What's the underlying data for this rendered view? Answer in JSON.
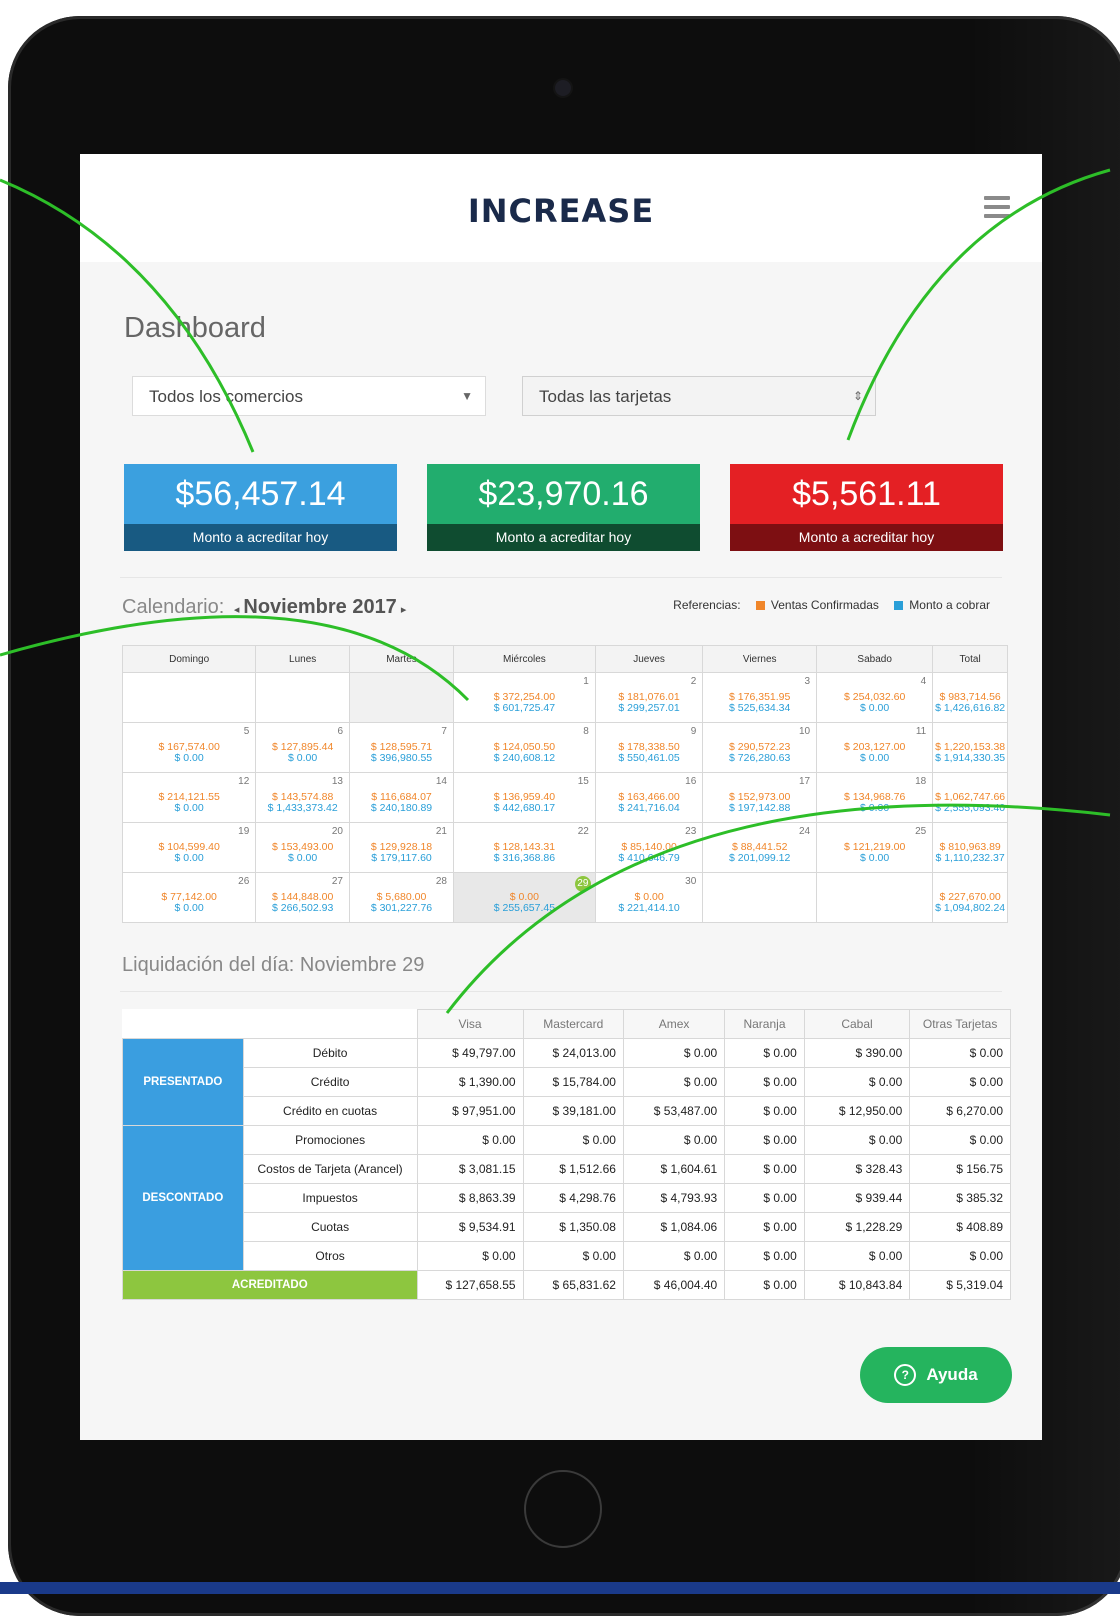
{
  "app": {
    "logo": "INCREASE"
  },
  "dashboard": {
    "title": "Dashboard"
  },
  "filters": {
    "merchant": "Todos los comercios",
    "cards": "Todas las tarjetas"
  },
  "cards": [
    {
      "amount": "$56,457.14",
      "label": "Monto a acreditar hoy",
      "color": "#3ba0df",
      "dark": "#185a82"
    },
    {
      "amount": "$23,970.16",
      "label": "Monto a acreditar hoy",
      "color": "#22ad6e",
      "dark": "#0f4c30"
    },
    {
      "amount": "$5,561.11",
      "label": "Monto a acreditar hoy",
      "color": "#e42024",
      "dark": "#7d0f12"
    }
  ],
  "calendar": {
    "label": "Calendario:",
    "month": "Noviembre 2017",
    "refs_label": "Referencias:",
    "ref_confirmed": "Ventas Confirmadas",
    "ref_collect": "Monto a cobrar",
    "orange": "#f0862a",
    "blue": "#2a9fd8",
    "headers": [
      "Domingo",
      "Lunes",
      "Martes",
      "Miércoles",
      "Jueves",
      "Viernes",
      "Sabado",
      "Total"
    ],
    "weeks": [
      [
        {
          "d": "",
          "o": "",
          "b": ""
        },
        {
          "d": "",
          "o": "",
          "b": ""
        },
        {
          "d": "",
          "o": "",
          "b": "",
          "shade": true
        },
        {
          "d": "1",
          "o": "$ 372,254.00",
          "b": "$ 601,725.47"
        },
        {
          "d": "2",
          "o": "$ 181,076.01",
          "b": "$ 299,257.01"
        },
        {
          "d": "3",
          "o": "$ 176,351.95",
          "b": "$ 525,634.34"
        },
        {
          "d": "4",
          "o": "$ 254,032.60",
          "b": "$ 0.00"
        },
        {
          "d": "",
          "o": "$ 983,714.56",
          "b": "$ 1,426,616.82"
        }
      ],
      [
        {
          "d": "5",
          "o": "$ 167,574.00",
          "b": "$ 0.00"
        },
        {
          "d": "6",
          "o": "$ 127,895.44",
          "b": "$ 0.00"
        },
        {
          "d": "7",
          "o": "$ 128,595.71",
          "b": "$ 396,980.55"
        },
        {
          "d": "8",
          "o": "$ 124,050.50",
          "b": "$ 240,608.12"
        },
        {
          "d": "9",
          "o": "$ 178,338.50",
          "b": "$ 550,461.05"
        },
        {
          "d": "10",
          "o": "$ 290,572.23",
          "b": "$ 726,280.63"
        },
        {
          "d": "11",
          "o": "$ 203,127.00",
          "b": "$ 0.00"
        },
        {
          "d": "",
          "o": "$ 1,220,153.38",
          "b": "$ 1,914,330.35"
        }
      ],
      [
        {
          "d": "12",
          "o": "$ 214,121.55",
          "b": "$ 0.00"
        },
        {
          "d": "13",
          "o": "$ 143,574.88",
          "b": "$ 1,433,373.42"
        },
        {
          "d": "14",
          "o": "$ 116,684.07",
          "b": "$ 240,180.89"
        },
        {
          "d": "15",
          "o": "$ 136,959.40",
          "b": "$ 442,680.17"
        },
        {
          "d": "16",
          "o": "$ 163,466.00",
          "b": "$ 241,716.04"
        },
        {
          "d": "17",
          "o": "$ 152,973.00",
          "b": "$ 197,142.88"
        },
        {
          "d": "18",
          "o": "$ 134,968.76",
          "b": "$ 0.00"
        },
        {
          "d": "",
          "o": "$ 1,062,747.66",
          "b": "$ 2,555,093.40"
        }
      ],
      [
        {
          "d": "19",
          "o": "$ 104,599.40",
          "b": "$ 0.00"
        },
        {
          "d": "20",
          "o": "$ 153,493.00",
          "b": "$ 0.00"
        },
        {
          "d": "21",
          "o": "$ 129,928.18",
          "b": "$ 179,117.60"
        },
        {
          "d": "22",
          "o": "$ 128,143.31",
          "b": "$ 316,368.86"
        },
        {
          "d": "23",
          "o": "$ 85,140.00",
          "b": "$ 410,646.79"
        },
        {
          "d": "24",
          "o": "$ 88,441.52",
          "b": "$ 201,099.12"
        },
        {
          "d": "25",
          "o": "$ 121,219.00",
          "b": "$ 0.00"
        },
        {
          "d": "",
          "o": "$ 810,963.89",
          "b": "$ 1,110,232.37"
        }
      ],
      [
        {
          "d": "26",
          "o": "$ 77,142.00",
          "b": "$ 0.00"
        },
        {
          "d": "27",
          "o": "$ 144,848.00",
          "b": "$ 266,502.93"
        },
        {
          "d": "28",
          "o": "$ 5,680.00",
          "b": "$ 301,227.76"
        },
        {
          "d": "29",
          "o": "$ 0.00",
          "b": "$ 255,657.45",
          "today": true
        },
        {
          "d": "30",
          "o": "$ 0.00",
          "b": "$ 221,414.10"
        },
        {
          "d": "",
          "o": "",
          "b": ""
        },
        {
          "d": "",
          "o": "",
          "b": ""
        },
        {
          "d": "",
          "o": "$ 227,670.00",
          "b": "$ 1,094,802.24"
        }
      ]
    ]
  },
  "liquidacion": {
    "title": "Liquidación del día: Noviembre 29",
    "columns": [
      "Visa",
      "Mastercard",
      "Amex",
      "Naranja",
      "Cabal",
      "Otras Tarjetas"
    ],
    "groups": [
      {
        "name": "PRESENTADO",
        "rows": [
          {
            "label": "Débito",
            "values": [
              "$ 49,797.00",
              "$ 24,013.00",
              "$ 0.00",
              "$ 0.00",
              "$ 390.00",
              "$ 0.00"
            ]
          },
          {
            "label": "Crédito",
            "values": [
              "$ 1,390.00",
              "$ 15,784.00",
              "$ 0.00",
              "$ 0.00",
              "$ 0.00",
              "$ 0.00"
            ]
          },
          {
            "label": "Crédito en cuotas",
            "values": [
              "$ 97,951.00",
              "$ 39,181.00",
              "$ 53,487.00",
              "$ 0.00",
              "$ 12,950.00",
              "$ 6,270.00"
            ]
          }
        ]
      },
      {
        "name": "DESCONTADO",
        "rows": [
          {
            "label": "Promociones",
            "values": [
              "$ 0.00",
              "$ 0.00",
              "$ 0.00",
              "$ 0.00",
              "$ 0.00",
              "$ 0.00"
            ]
          },
          {
            "label": "Costos de Tarjeta (Arancel)",
            "values": [
              "$ 3,081.15",
              "$ 1,512.66",
              "$ 1,604.61",
              "$ 0.00",
              "$ 328.43",
              "$ 156.75"
            ]
          },
          {
            "label": "Impuestos",
            "values": [
              "$ 8,863.39",
              "$ 4,298.76",
              "$ 4,793.93",
              "$ 0.00",
              "$ 939.44",
              "$ 385.32"
            ]
          },
          {
            "label": "Cuotas",
            "values": [
              "$ 9,534.91",
              "$ 1,350.08",
              "$ 1,084.06",
              "$ 0.00",
              "$ 1,228.29",
              "$ 408.89"
            ]
          },
          {
            "label": "Otros",
            "values": [
              "$ 0.00",
              "$ 0.00",
              "$ 0.00",
              "$ 0.00",
              "$ 0.00",
              "$ 0.00"
            ]
          }
        ]
      }
    ],
    "total": {
      "label": "ACREDITADO",
      "values": [
        "$ 127,658.55",
        "$ 65,831.62",
        "$ 46,004.40",
        "$ 0.00",
        "$ 10,843.84",
        "$ 5,319.04"
      ]
    }
  },
  "help": {
    "label": "Ayuda",
    "icon": "question-icon"
  },
  "callout_color": "#2dbe28"
}
